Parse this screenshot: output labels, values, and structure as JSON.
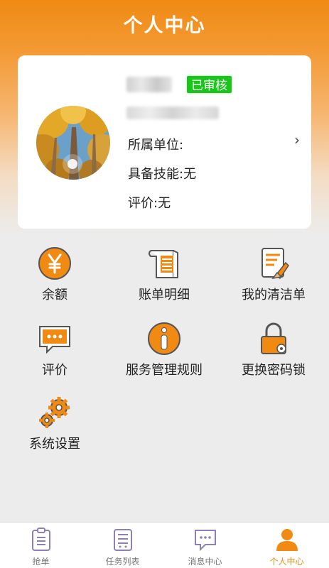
{
  "header": {
    "title": "个人中心"
  },
  "profile": {
    "status_badge": "已审核",
    "unit_label": "所属单位:",
    "skills_label": "具备技能:无",
    "rating_label": "评价:无",
    "chevron": "›"
  },
  "grid": {
    "balance": "余额",
    "bill_detail": "账单明细",
    "my_cleaning": "我的清洁单",
    "rating": "评价",
    "service_rules": "服务管理规则",
    "change_lock": "更换密码锁",
    "settings": "系统设置"
  },
  "tabbar": {
    "grab": "抢单",
    "tasks": "任务列表",
    "messages": "消息中心",
    "profile": "个人中心"
  },
  "colors": {
    "accent": "#f08a13",
    "badge": "#19c619",
    "icon_outline": "#555555"
  }
}
